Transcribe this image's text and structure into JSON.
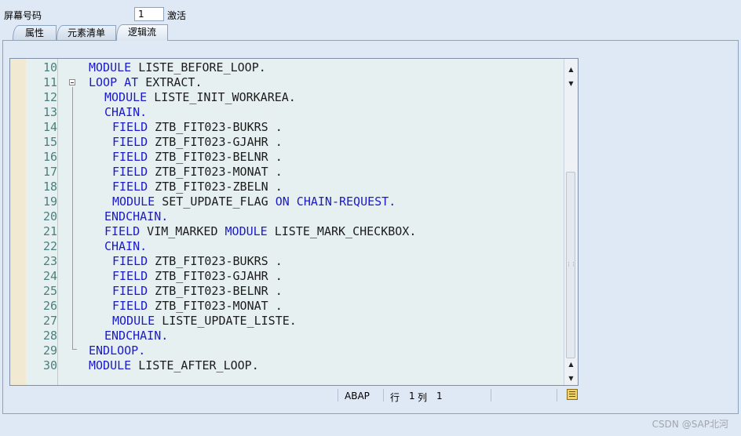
{
  "header": {
    "screen_number_label": "屏幕号码",
    "screen_number_value": "1",
    "status_label": "激活"
  },
  "tabs": [
    {
      "label": "属性",
      "active": false
    },
    {
      "label": "元素清单",
      "active": false
    },
    {
      "label": "逻辑流",
      "active": true
    }
  ],
  "editor": {
    "lines": [
      {
        "n": "10",
        "indent": 0,
        "tokens": [
          [
            "kw",
            "MODULE"
          ],
          [
            "id",
            " LISTE_BEFORE_LOOP."
          ]
        ]
      },
      {
        "n": "11",
        "indent": 0,
        "tokens": [
          [
            "kw",
            "LOOP AT"
          ],
          [
            "id",
            " EXTRACT."
          ]
        ]
      },
      {
        "n": "12",
        "indent": 2,
        "tokens": [
          [
            "kw",
            "MODULE"
          ],
          [
            "id",
            " LISTE_INIT_WORKAREA."
          ]
        ]
      },
      {
        "n": "13",
        "indent": 2,
        "tokens": [
          [
            "kw",
            "CHAIN."
          ]
        ]
      },
      {
        "n": "14",
        "indent": 3,
        "tokens": [
          [
            "kw",
            "FIELD"
          ],
          [
            "id",
            " ZTB_FIT023-BUKRS ."
          ]
        ]
      },
      {
        "n": "15",
        "indent": 3,
        "tokens": [
          [
            "kw",
            "FIELD"
          ],
          [
            "id",
            " ZTB_FIT023-GJAHR ."
          ]
        ]
      },
      {
        "n": "16",
        "indent": 3,
        "tokens": [
          [
            "kw",
            "FIELD"
          ],
          [
            "id",
            " ZTB_FIT023-BELNR ."
          ]
        ]
      },
      {
        "n": "17",
        "indent": 3,
        "tokens": [
          [
            "kw",
            "FIELD"
          ],
          [
            "id",
            " ZTB_FIT023-MONAT ."
          ]
        ]
      },
      {
        "n": "18",
        "indent": 3,
        "tokens": [
          [
            "kw",
            "FIELD"
          ],
          [
            "id",
            " ZTB_FIT023-ZBELN ."
          ]
        ]
      },
      {
        "n": "19",
        "indent": 3,
        "tokens": [
          [
            "kw",
            "MODULE"
          ],
          [
            "id",
            " SET_UPDATE_FLAG "
          ],
          [
            "kw",
            "ON CHAIN-REQUEST."
          ]
        ]
      },
      {
        "n": "20",
        "indent": 2,
        "tokens": [
          [
            "kw",
            "ENDCHAIN."
          ]
        ]
      },
      {
        "n": "21",
        "indent": 2,
        "tokens": [
          [
            "kw",
            "FIELD"
          ],
          [
            "id",
            " VIM_MARKED "
          ],
          [
            "kw",
            "MODULE"
          ],
          [
            "id",
            " LISTE_MARK_CHECKBOX."
          ]
        ]
      },
      {
        "n": "22",
        "indent": 2,
        "tokens": [
          [
            "kw",
            "CHAIN."
          ]
        ]
      },
      {
        "n": "23",
        "indent": 3,
        "tokens": [
          [
            "kw",
            "FIELD"
          ],
          [
            "id",
            " ZTB_FIT023-BUKRS ."
          ]
        ]
      },
      {
        "n": "24",
        "indent": 3,
        "tokens": [
          [
            "kw",
            "FIELD"
          ],
          [
            "id",
            " ZTB_FIT023-GJAHR ."
          ]
        ]
      },
      {
        "n": "25",
        "indent": 3,
        "tokens": [
          [
            "kw",
            "FIELD"
          ],
          [
            "id",
            " ZTB_FIT023-BELNR ."
          ]
        ]
      },
      {
        "n": "26",
        "indent": 3,
        "tokens": [
          [
            "kw",
            "FIELD"
          ],
          [
            "id",
            " ZTB_FIT023-MONAT ."
          ]
        ]
      },
      {
        "n": "27",
        "indent": 3,
        "tokens": [
          [
            "kw",
            "MODULE"
          ],
          [
            "id",
            " LISTE_UPDATE_LISTE."
          ]
        ]
      },
      {
        "n": "28",
        "indent": 2,
        "tokens": [
          [
            "kw",
            "ENDCHAIN."
          ]
        ]
      },
      {
        "n": "29",
        "indent": 0,
        "tokens": [
          [
            "kw",
            "ENDLOOP."
          ]
        ]
      },
      {
        "n": "30",
        "indent": 0,
        "tokens": [
          [
            "kw",
            "MODULE"
          ],
          [
            "id",
            " LISTE_AFTER_LOOP."
          ]
        ]
      }
    ]
  },
  "statusbar": {
    "language": "ABAP",
    "row_label": "行",
    "row_value": "1",
    "col_label": "列",
    "col_value": "1"
  },
  "watermark": "CSDN @SAP北河",
  "icons": {
    "fold": "collapse-box-icon",
    "scroll_up": "triangle-up-icon",
    "scroll_down": "triangle-down-icon",
    "status": "notepad-icon"
  },
  "colors": {
    "keyword": "#1a1ac8",
    "identifier": "#1c1c1c",
    "line_number": "#4a7f7f",
    "editor_bg": "#e7f0f0",
    "margin_bg": "#f2e9d2"
  }
}
